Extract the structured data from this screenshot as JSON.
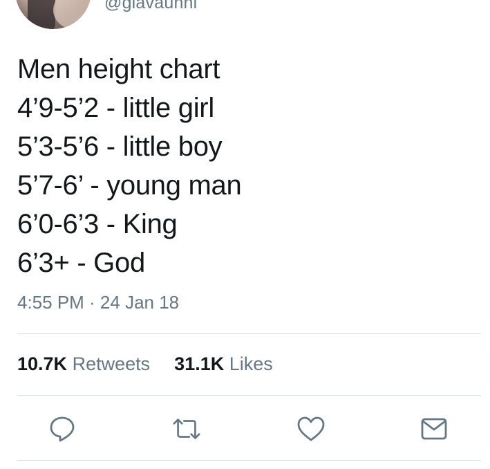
{
  "author": {
    "handle": "@giavaunni"
  },
  "tweet": {
    "lines": [
      "Men height chart",
      "4’9-5’2 - little girl",
      "5’3-5’6 - little boy",
      "5’7-6’ - young man",
      "6’0-6’3 - King",
      "6’3+ - God"
    ],
    "timestamp": "4:55 PM · 24 Jan 18"
  },
  "stats": {
    "retweets_count": "10.7K",
    "retweets_label": "Retweets",
    "likes_count": "31.1K",
    "likes_label": "Likes"
  },
  "actions": [
    {
      "icon": "reply-icon"
    },
    {
      "icon": "retweet-icon"
    },
    {
      "icon": "like-heart-icon"
    },
    {
      "icon": "share-mail-icon"
    }
  ],
  "colors": {
    "text": "#14171a",
    "secondary": "#657786",
    "divider": "#d8dfe4"
  }
}
